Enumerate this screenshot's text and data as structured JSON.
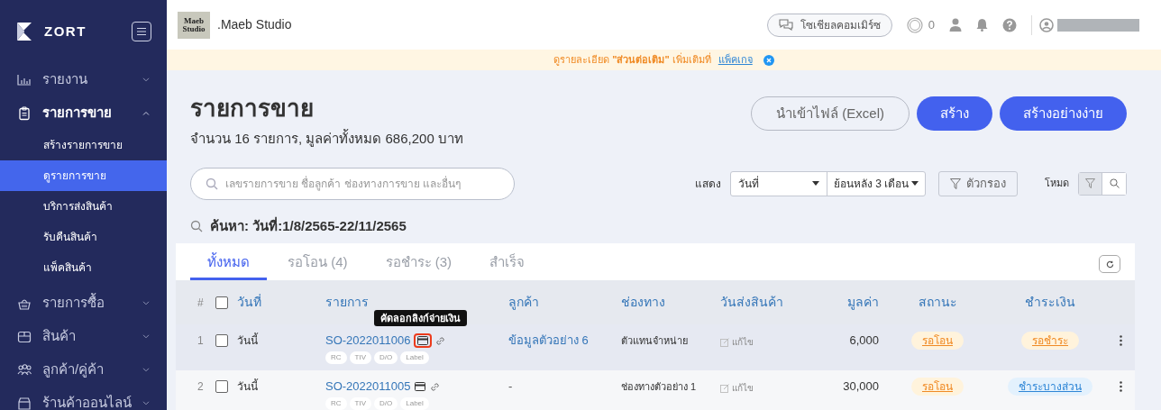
{
  "sidebar": {
    "brand": "ZORT",
    "items": [
      {
        "label": "รายงาน",
        "kind": "chart",
        "expanded": false
      },
      {
        "label": "รายการขาย",
        "kind": "clipboard",
        "expanded": true,
        "children": [
          {
            "label": "สร้างรายการขาย",
            "selected": false
          },
          {
            "label": "ดูรายการขาย",
            "selected": true
          },
          {
            "label": "บริการส่งสินค้า",
            "selected": false
          },
          {
            "label": "รับคืนสินค้า",
            "selected": false
          },
          {
            "label": "แพ็คสินค้า",
            "selected": false
          }
        ]
      },
      {
        "label": "รายการซื้อ",
        "kind": "basket",
        "expanded": false
      },
      {
        "label": "สินค้า",
        "kind": "box",
        "expanded": false
      },
      {
        "label": "ลูกค้า/คู่ค้า",
        "kind": "people",
        "expanded": false
      },
      {
        "label": "ร้านค้าออนไลน์",
        "kind": "store",
        "expanded": false
      }
    ]
  },
  "header": {
    "store_logo": "Maeb Studio",
    "store_name": ".Maeb Studio",
    "social_button": "โซเชียลคอมเมิร์ซ",
    "points": "0"
  },
  "banner": {
    "text": "ดูรายละเอียด **\"ส่วนต่อเติม\"** เพิ่มเติมที่",
    "link": "แพ็คเกจ"
  },
  "page": {
    "title": "รายการขาย",
    "subtitle": "จำนวน 16 รายการ, มูลค่าทั้งหมด 686,200 บาท",
    "buttons": [
      {
        "label": "นำเข้าไฟล์ (Excel)",
        "kind": "outline"
      },
      {
        "label": "สร้าง",
        "kind": "primary"
      },
      {
        "label": "สร้างอย่างง่าย",
        "kind": "primary"
      }
    ]
  },
  "search": {
    "placeholder": "เลขรายการขาย ชื่อลูกค้า ช่องทางการขาย และอื่นๆ"
  },
  "filters": {
    "show_label": "แสดง",
    "date_field": "วันที่",
    "range": "ย้อนหลัง 3 เดือน",
    "filter_button": "ตัวกรอง",
    "mode_label": "โหมด",
    "modes": [
      {
        "kind": "filter",
        "selected": true
      },
      {
        "kind": "search",
        "selected": false
      }
    ]
  },
  "search_summary": "ค้นหา: วันที่:1/8/2565-22/11/2565",
  "tabs": [
    {
      "label": "ทั้งหมด",
      "selected": true
    },
    {
      "label": "รอโอน (4)",
      "selected": false
    },
    {
      "label": "รอชำระ (3)",
      "selected": false
    },
    {
      "label": "สำเร็จ",
      "selected": false
    }
  ],
  "table": {
    "select_all_checked": false,
    "columns": [
      "#",
      "วันที่",
      "รายการ",
      "ลูกค้า",
      "ช่องทาง",
      "วันส่งสินค้า",
      "มูลค่า",
      "สถานะ",
      "ชำระเงิน"
    ],
    "rows": [
      {
        "number": "1",
        "checked": false,
        "hovered": true,
        "date": "วันนี้",
        "order": "SO-2022011006",
        "tags": [
          "RC",
          "TIV",
          "D/O",
          "Label"
        ],
        "tooltip": "คัดลอกลิงก์จ่ายเงิน",
        "customer": "ข้อมูลตัวอย่าง 6",
        "channel": "ตัวแทนจำหน่าย",
        "ship_edit": "แก้ไข",
        "value": "6,000",
        "status": {
          "label": "รอโอน",
          "color": "#f08a24"
        },
        "payment": {
          "label": "รอชำระ",
          "color": "#f08a24"
        }
      },
      {
        "number": "2",
        "checked": false,
        "hovered": false,
        "date": "วันนี้",
        "order": "SO-2022011005",
        "tags": [
          "RC",
          "TIV",
          "D/O",
          "Label"
        ],
        "customer": "-",
        "channel": "ช่องทางตัวอย่าง 1",
        "ship_edit": "แก้ไข",
        "value": "30,000",
        "status": {
          "label": "รอโอน",
          "color": "#f08a24"
        },
        "payment": {
          "label": "ชำระบางส่วน",
          "color": "#2f86d6"
        }
      }
    ]
  }
}
